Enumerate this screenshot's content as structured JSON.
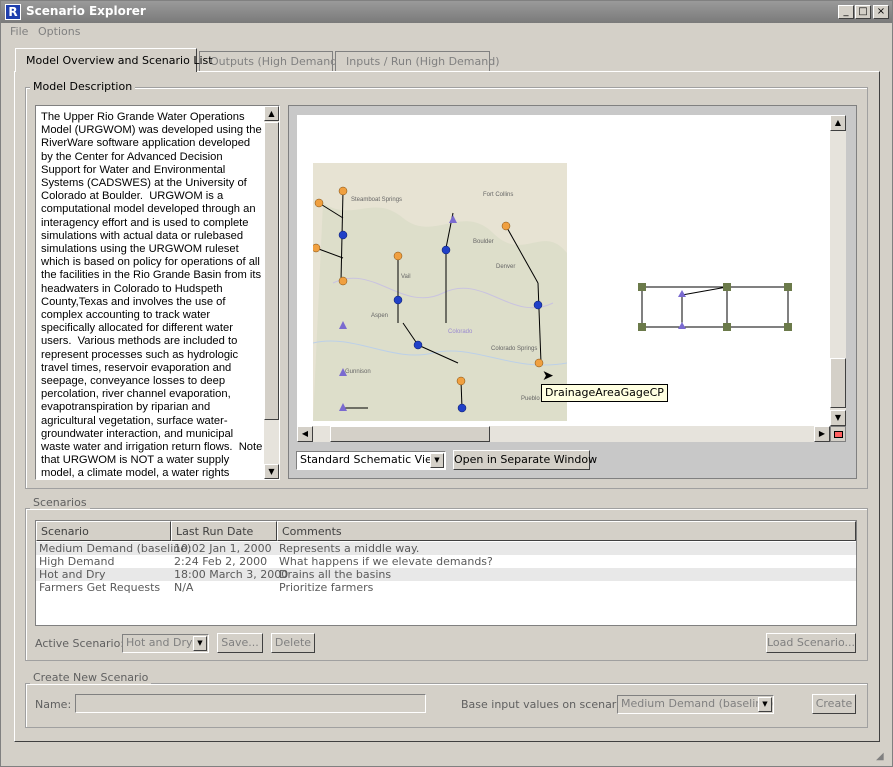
{
  "window": {
    "title": "Scenario Explorer",
    "controls": {
      "minimize": "_",
      "maximize": "□",
      "close": "×"
    }
  },
  "menu": [
    "File",
    "Options"
  ],
  "tabs": [
    {
      "label": "Model Overview and Scenario List",
      "active": true
    },
    {
      "label": "Outputs (High Demand)",
      "active": false
    },
    {
      "label": "Inputs / Run (High Demand)",
      "active": false
    }
  ],
  "model_description": {
    "group_title": "Model Description",
    "text": "The Upper Rio Grande Water Operations Model (URGWOM) was developed using the RiverWare software application developed by the Center for Advanced Decision Support for Water and Environmental Systems (CADSWES) at the University of Colorado at Boulder.  URGWOM is a computational model developed through an interagency effort and is used to complete simulations with actual data or rulebased simulations using the URGWOM ruleset which is based on policy for operations of all the facilities in the Rio Grande Basin from its headwaters in Colorado to Hudspeth County,Texas and involves the use of complex accounting to track water specifically allocated for different water users.  Various methods are included to represent processes such as hydrologic travel times, reservoir evaporation and seepage, conveyance losses to deep percolation, river channel evaporation, evapotranspiration by riparian and agricultural vegetation, surface water-groundwater interaction, and municipal waste water and irrigation return flows.  Note that URGWOM is NOT a water supply model, a climate model, a water rights model, a rainfall/runoff model, a hydraulic model, or a"
  },
  "schematic": {
    "map_labels": [
      "Steamboat Springs",
      "Fort Collins",
      "Boulder",
      "Denver",
      "Aspen",
      "Colorado",
      "Colorado Springs",
      "Gunnison",
      "Pueblo",
      "Vail"
    ],
    "tooltip": "DrainageAreaGageCP",
    "view_select": "Standard Schematic View",
    "open_button": "Open in Separate Window"
  },
  "scenarios": {
    "group_title": "Scenarios",
    "columns": [
      "Scenario",
      "Last Run Date",
      "Comments"
    ],
    "rows": [
      {
        "scenario": "Medium Demand (baseline)",
        "date": "10:02 Jan 1, 2000",
        "comment": "Represents a middle way."
      },
      {
        "scenario": "High Demand",
        "date": "2:24 Feb 2, 2000",
        "comment": "What happens if we elevate demands?"
      },
      {
        "scenario": "Hot and Dry",
        "date": "18:00 March 3, 2000",
        "comment": "Drains all the basins"
      },
      {
        "scenario": "Farmers Get Requests",
        "date": "N/A",
        "comment": "Prioritize farmers"
      }
    ],
    "active_label": "Active Scenario:",
    "active_value": "Hot and Dry",
    "save_button": "Save...",
    "delete_button": "Delete",
    "load_button": "Load Scenario..."
  },
  "create_new": {
    "group_title": "Create New Scenario",
    "name_label": "Name:",
    "name_value": "",
    "base_label": "Base input values on scenario:",
    "base_value": "Medium Demand (baseline)",
    "create_button": "Create"
  },
  "colors": {
    "node_orange": "#f0a040",
    "node_blue": "#2040c8",
    "title_bar": "#8a8a8a"
  }
}
